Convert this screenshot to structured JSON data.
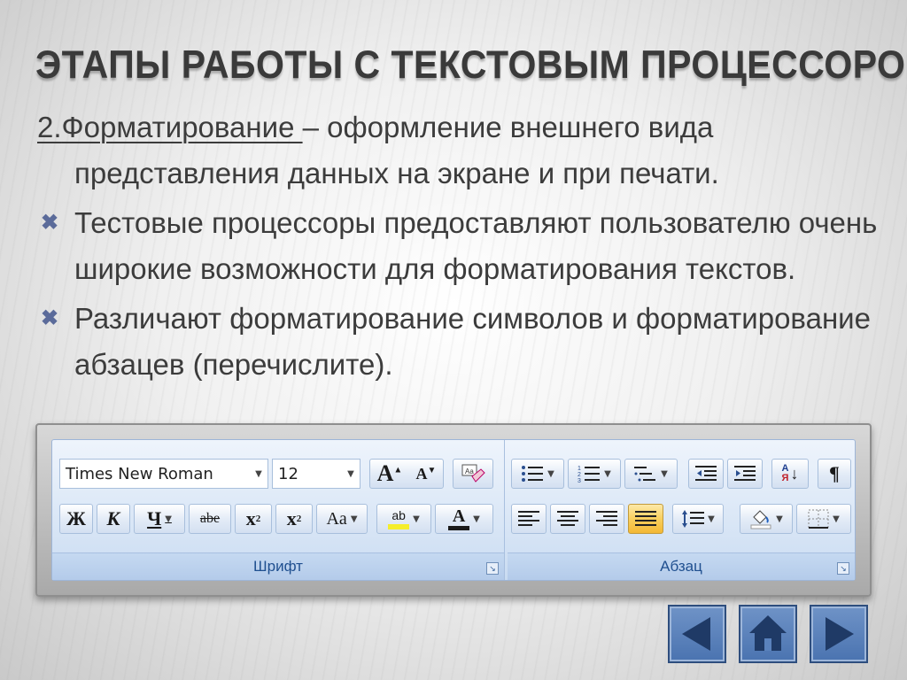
{
  "slide": {
    "title": "ЭТАПЫ РАБОТЫ С ТЕКСТОВЫМ ПРОЦЕССОРОМ",
    "intro_number": "2.",
    "intro_term": "Форматирование ",
    "intro_rest": "– оформление внешнего вида представления данных на экране и при печати.",
    "bullets": [
      "Тестовые процессоры предоставляют пользователю очень широкие возможности для форматирования текстов.",
      "Различают форматирование символов и форматирование абзацев (перечислите)."
    ],
    "bullet_icon": "cross-bullet-icon"
  },
  "ribbon": {
    "font_group": {
      "label": "Шрифт",
      "font_name": "Times New Roman",
      "font_size": "12",
      "grow_font": "A",
      "shrink_font": "A",
      "bold": "Ж",
      "italic": "К",
      "underline": "Ч",
      "strike": "abe",
      "subscript": "x",
      "subscript_mark": "2",
      "superscript": "x",
      "superscript_mark": "2",
      "change_case": "Aa",
      "highlight": "ab",
      "font_color": "A"
    },
    "paragraph_group": {
      "label": "Абзац",
      "sort_label": "Я",
      "pilcrow": "¶",
      "active_alignment": "justify"
    }
  },
  "nav": {
    "prev": "prev-slide",
    "home": "home",
    "next": "next-slide"
  }
}
